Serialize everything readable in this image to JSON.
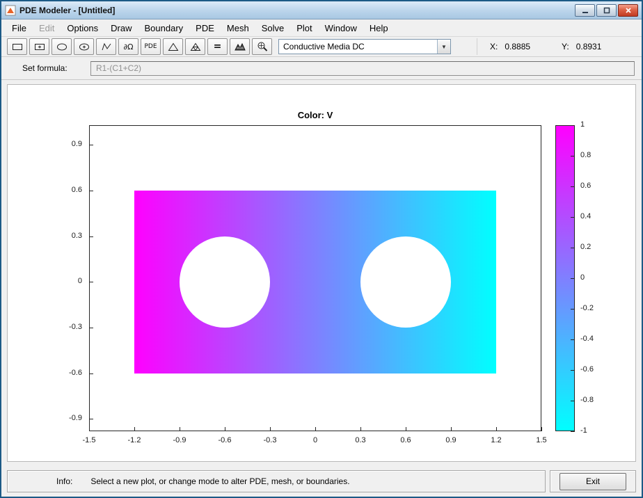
{
  "window": {
    "title": "PDE Modeler - [Untitled]"
  },
  "menu": {
    "items": [
      {
        "label": "File",
        "enabled": true
      },
      {
        "label": "Edit",
        "enabled": false
      },
      {
        "label": "Options",
        "enabled": true
      },
      {
        "label": "Draw",
        "enabled": true
      },
      {
        "label": "Boundary",
        "enabled": true
      },
      {
        "label": "PDE",
        "enabled": true
      },
      {
        "label": "Mesh",
        "enabled": true
      },
      {
        "label": "Solve",
        "enabled": true
      },
      {
        "label": "Plot",
        "enabled": true
      },
      {
        "label": "Window",
        "enabled": true
      },
      {
        "label": "Help",
        "enabled": true
      }
    ]
  },
  "toolbar": {
    "draw_labels": {
      "boundary": "∂Ω",
      "pde": "PDE",
      "solve": "="
    },
    "mode_select": {
      "value": "Conductive Media DC"
    },
    "coords": {
      "x_label": "X:",
      "x_value": "0.8885",
      "y_label": "Y:",
      "y_value": "0.8931"
    }
  },
  "formula": {
    "label": "Set formula:",
    "value": "R1-(C1+C2)"
  },
  "plot": {
    "title": "Color: V",
    "xlim": [
      -1.5,
      1.5
    ],
    "ylim": [
      -0.98,
      1.03
    ],
    "x_ticks": [
      -1.5,
      -1.2,
      -0.9,
      -0.6,
      -0.3,
      0,
      0.3,
      0.6,
      0.9,
      1.2,
      1.5
    ],
    "x_tick_labels": [
      "-1.5",
      "-1.2",
      "-0.9",
      "-0.6",
      "-0.3",
      "0",
      "0.3",
      "0.6",
      "0.9",
      "1.2",
      "1.5"
    ],
    "y_ticks": [
      0.9,
      0.6,
      0.3,
      0,
      -0.3,
      -0.6,
      -0.9
    ],
    "y_tick_labels": [
      "0.9",
      "0.6",
      "0.3",
      "0",
      "-0.3",
      "-0.6",
      "-0.9"
    ],
    "geometry": {
      "rectangle": {
        "x": [
          -1.2,
          1.2
        ],
        "y": [
          -0.6,
          0.6
        ]
      },
      "holes": [
        {
          "cx": -0.6,
          "cy": 0,
          "r": 0.3
        },
        {
          "cx": 0.6,
          "cy": 0,
          "r": 0.3
        }
      ]
    },
    "colormap": {
      "max_color": "#ff00ff",
      "min_color": "#00ffff"
    },
    "colorbar": {
      "range": [
        -1,
        1
      ],
      "tick_labels": [
        "1",
        "0.8",
        "0.6",
        "0.4",
        "0.2",
        "0",
        "-0.2",
        "-0.4",
        "-0.6",
        "-0.8",
        "-1"
      ]
    }
  },
  "status": {
    "info_label": "Info:",
    "message": "Select a new plot, or change mode to alter PDE, mesh, or boundaries.",
    "exit_label": "Exit"
  }
}
